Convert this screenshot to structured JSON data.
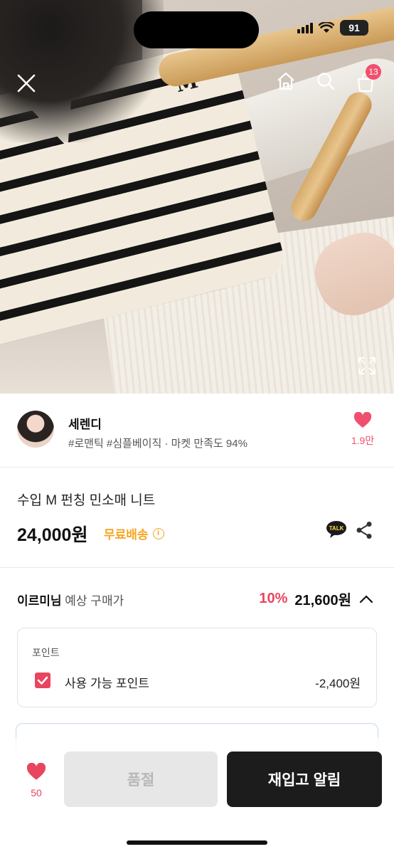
{
  "status_bar": {
    "battery": "91"
  },
  "hero": {
    "close_icon": "close-icon",
    "home_icon": "home-icon",
    "search_icon": "search-icon",
    "cart_icon": "cart-icon",
    "cart_badge": "13",
    "expand_icon": "expand-icon",
    "garment_letter": "M"
  },
  "seller": {
    "name": "세렌디",
    "tags": "#로맨틱 #심플베이직 · 마켓 만족도 94%",
    "like_count": "1.9만"
  },
  "product": {
    "title": "수입 M 펀칭 민소매 니트",
    "price": "24,000원",
    "shipping": "무료배송",
    "info_glyph": "i",
    "talk_label": "TALK"
  },
  "membership": {
    "name": "이르미님",
    "label": "예상 구매가",
    "discount_rate": "10%",
    "price": "21,600원"
  },
  "points": {
    "header": "포인트",
    "item_label": "사용 가능 포인트",
    "amount": "-2,400원"
  },
  "bottom_bar": {
    "wish_count": "50",
    "soldout_label": "품절",
    "restock_label": "재입고 알림"
  },
  "colors": {
    "accent_pink": "#e8465f",
    "shipping_orange": "#f5a623",
    "primary_button": "#1c1c1c"
  }
}
